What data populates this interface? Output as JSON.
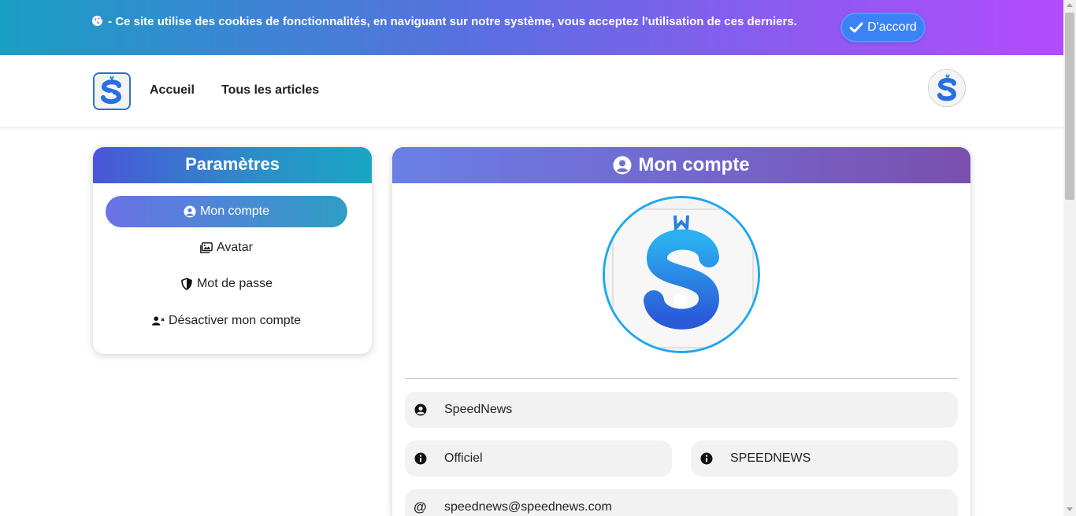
{
  "cookie_banner": {
    "text": "- Ce site utilise des cookies de fonctionnalités, en naviguant sur notre système, vous acceptez l'utilisation de ces derniers.",
    "accept_label": "D'accord"
  },
  "nav": {
    "links": [
      "Accueil",
      "Tous les articles"
    ]
  },
  "sidebar": {
    "title": "Paramètres",
    "items": [
      {
        "label": "Mon compte",
        "icon": "user-circle-icon",
        "active": true
      },
      {
        "label": "Avatar",
        "icon": "images-icon",
        "active": false
      },
      {
        "label": "Mot de passe",
        "icon": "shield-icon",
        "active": false
      },
      {
        "label": "Désactiver mon compte",
        "icon": "user-xmark-icon",
        "active": false
      }
    ]
  },
  "account": {
    "title": "Mon compte",
    "fields": {
      "username": "SpeedNews",
      "first_name": "Officiel",
      "last_name": "SPEEDNEWS",
      "email": "speednews@speednews.com"
    }
  },
  "colors": {
    "accent_blue": "#3b82f6",
    "logo_blue": "#1ea8ef",
    "sidebar_gradient_start": "#4a56d8",
    "account_gradient_end": "#7b4fae"
  }
}
